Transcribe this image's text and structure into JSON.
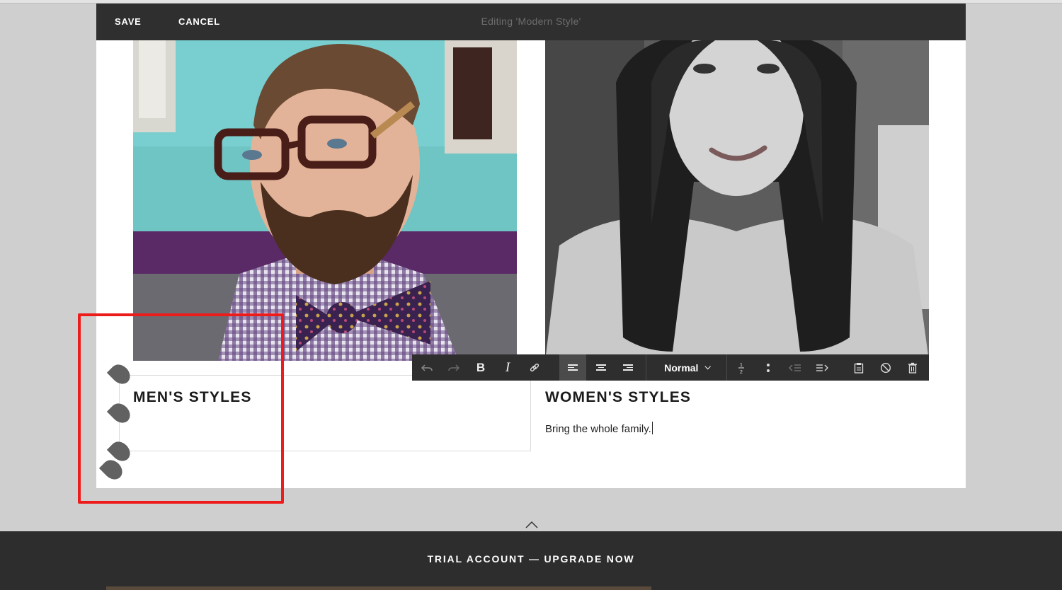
{
  "editor": {
    "save_label": "SAVE",
    "cancel_label": "CANCEL",
    "title": "Editing 'Modern Style'"
  },
  "content": {
    "men": {
      "heading": "MEN'S STYLES"
    },
    "women": {
      "heading": "WOMEN'S STYLES",
      "body": "Bring the whole family."
    }
  },
  "toolbar": {
    "format_value": "Normal",
    "icons": [
      "undo-icon",
      "redo-icon",
      "bold-icon",
      "italic-icon",
      "link-icon",
      "align-left-icon",
      "align-center-icon",
      "align-right-icon",
      "ordered-list-icon",
      "unordered-list-icon",
      "outdent-icon",
      "indent-icon",
      "paste-icon",
      "clear-format-icon",
      "trash-icon"
    ],
    "active_button": "align-left"
  },
  "footer": {
    "trial_label": "TRIAL ACCOUNT — UPGRADE NOW"
  },
  "colors": {
    "edit_bar": "#2f2f2f",
    "canvas": "#ffffff",
    "page_bg": "#cfcfcf",
    "annotation": "#ee1b1b",
    "handle": "#616161",
    "footer": "#2d2d2d"
  }
}
